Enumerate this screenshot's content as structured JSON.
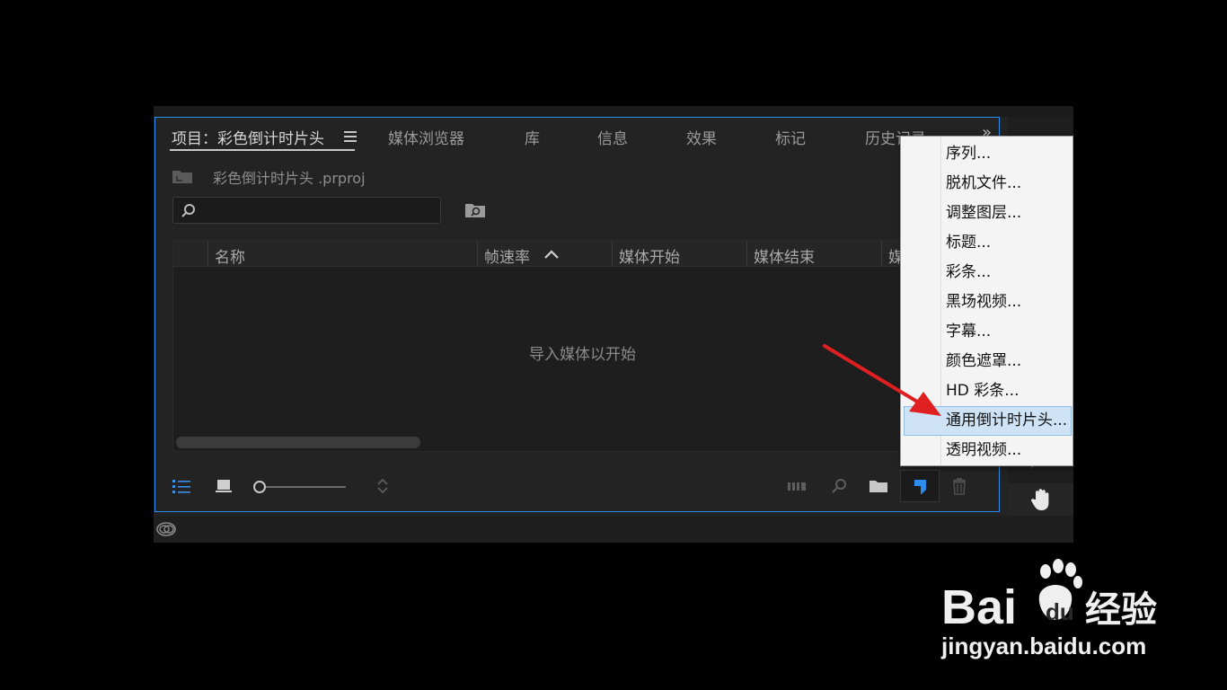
{
  "panel": {
    "tabs": [
      "项目：彩色倒计时片头",
      "媒体浏览器",
      "库",
      "信息",
      "效果",
      "标记",
      "历史记录"
    ],
    "project_file": "彩色倒计时片头 .prproj",
    "search": {
      "value": "",
      "placeholder": ""
    },
    "columns": [
      "名称",
      "帧速率",
      "媒体开始",
      "媒体结束",
      "媒"
    ],
    "empty_message": "导入媒体以开始"
  },
  "context_menu": {
    "items": [
      "序列...",
      "脱机文件...",
      "调整图层...",
      "标题...",
      "彩条...",
      "黑场视频...",
      "字幕...",
      "颜色遮罩...",
      "HD 彩条...",
      "通用倒计时片头...",
      "透明视频..."
    ],
    "highlighted_index": 9
  },
  "watermark": {
    "logo_text": "Baidu经验",
    "url": "jingyan.baidu.com"
  },
  "colors": {
    "accent": "#2d8ceb",
    "highlight": "#cfe3f7",
    "arrow": "#e02020"
  }
}
